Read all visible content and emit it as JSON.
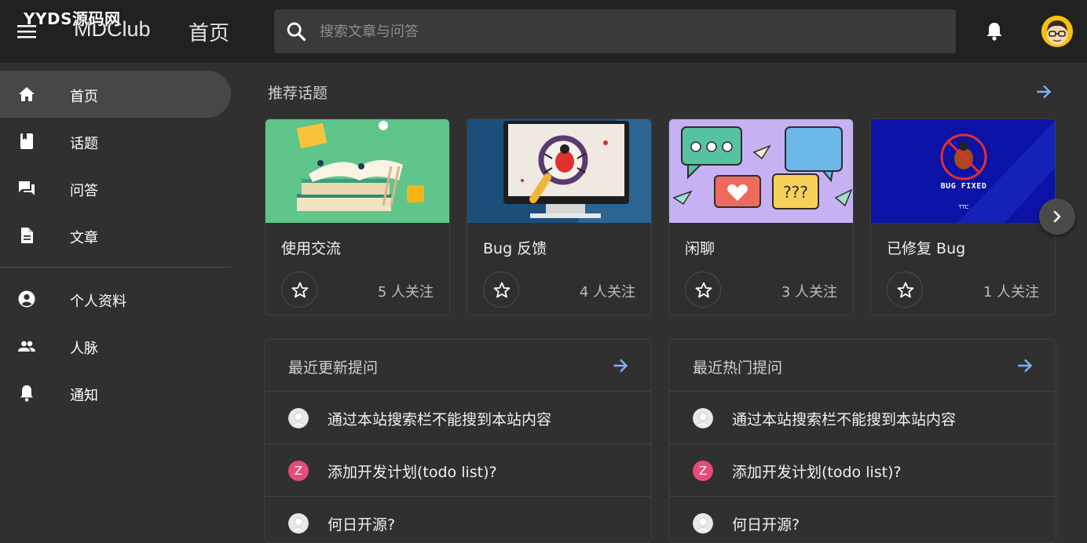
{
  "watermark": "YYDS源码网",
  "appbar": {
    "brand": "MDClub",
    "title": "首页",
    "search_placeholder": "搜索文章与问答"
  },
  "drawer": {
    "items": [
      {
        "label": "首页",
        "icon": "home-icon",
        "active": true
      },
      {
        "label": "话题",
        "icon": "book-icon"
      },
      {
        "label": "问答",
        "icon": "forum-icon"
      },
      {
        "label": "文章",
        "icon": "description-icon"
      },
      {
        "label": "个人资料",
        "icon": "account-circle-icon"
      },
      {
        "label": "人脉",
        "icon": "people-icon"
      },
      {
        "label": "通知",
        "icon": "bell-icon"
      }
    ]
  },
  "recommended": {
    "title": "推荐话题",
    "topics": [
      {
        "name": "使用交流",
        "followers": "5 人关注",
        "cover": "books-illustration"
      },
      {
        "name": "Bug 反馈",
        "followers": "4 人关注",
        "cover": "bug-magnifier-illustration"
      },
      {
        "name": "闲聊",
        "followers": "3 人关注",
        "cover": "chat-bubbles-illustration"
      },
      {
        "name": "已修复 Bug",
        "followers": "1 人关注",
        "cover": "bug-fixed-illustration",
        "cover_text": "BUG FIXED",
        "cover_badge": "TTC"
      }
    ]
  },
  "recent_questions": {
    "title": "最近更新提问",
    "items": [
      {
        "text": "通过本站搜索栏不能搜到本站内容",
        "avatar": "default"
      },
      {
        "text": "添加开发计划(todo list)?",
        "avatar": "Z"
      },
      {
        "text": "何日开源?",
        "avatar": "default"
      }
    ]
  },
  "hot_questions": {
    "title": "最近热门提问",
    "items": [
      {
        "text": "通过本站搜索栏不能搜到本站内容",
        "avatar": "default"
      },
      {
        "text": "添加开发计划(todo list)?",
        "avatar": "Z"
      },
      {
        "text": "何日开源?",
        "avatar": "default"
      }
    ]
  },
  "colors": {
    "appbar": "#212121",
    "background": "#303030",
    "accent_arrow": "#82b1ff",
    "active_nav": "#474747",
    "avatar_z": "#e84a7a"
  }
}
